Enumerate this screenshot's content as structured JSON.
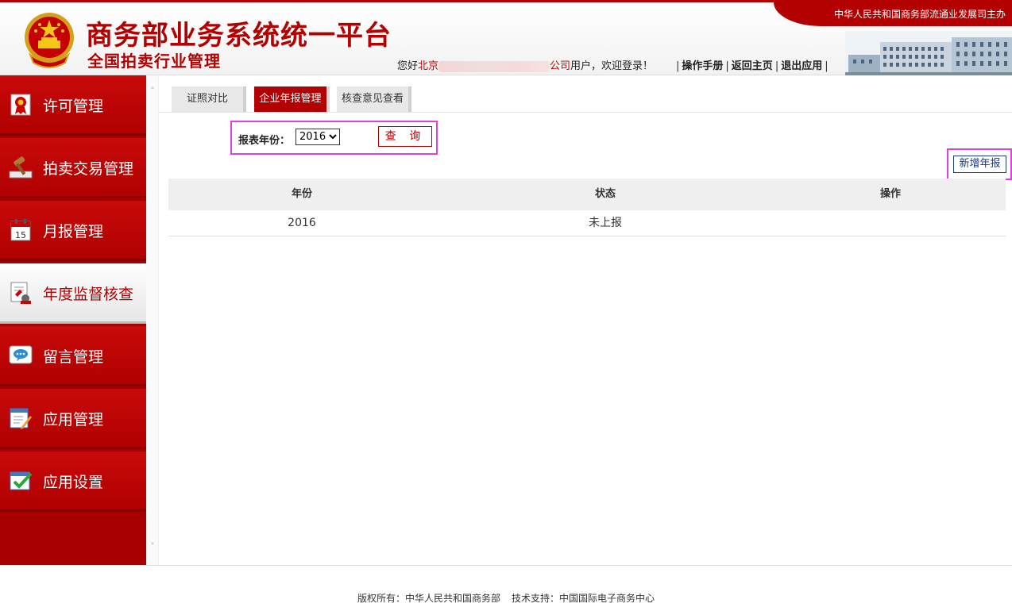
{
  "header": {
    "title_main": "商务部业务系统统一平台",
    "title_sub": "全国拍卖行业管理",
    "sponsor": "中华人民共和国商务部流通业发展司主办",
    "welcome_prefix": "您好",
    "welcome_company_start": "北京",
    "welcome_company_end": "公司",
    "welcome_suffix": "用户，欢迎登录！",
    "links": [
      "操作手册",
      "返回主页",
      "退出应用"
    ]
  },
  "sidebar": {
    "items": [
      {
        "label": "许可管理",
        "icon": "certificate-icon"
      },
      {
        "label": "拍卖交易管理",
        "icon": "gavel-icon"
      },
      {
        "label": "月报管理",
        "icon": "calendar-icon"
      },
      {
        "label": "年度监督核查",
        "icon": "inspection-icon"
      },
      {
        "label": "留言管理",
        "icon": "message-icon"
      },
      {
        "label": "应用管理",
        "icon": "edit-icon"
      },
      {
        "label": "应用设置",
        "icon": "checklist-icon"
      }
    ],
    "active_index": 3
  },
  "tabs": [
    "证照对比",
    "企业年报管理",
    "核查意见查看"
  ],
  "active_tab": 1,
  "query": {
    "label": "报表年份：",
    "selected_year": "2016",
    "button": "查 询"
  },
  "add_button": "新增年报",
  "table": {
    "columns": [
      "年份",
      "状态",
      "操作"
    ],
    "rows": [
      {
        "year": "2016",
        "status": "未上报",
        "action": ""
      }
    ]
  },
  "footer": {
    "copyright": "版权所有：中华人民共和国商务部",
    "support": "技术支持：中国国际电子商务中心"
  },
  "colors": {
    "brand_red": "#b30000",
    "highlight_magenta": "#e040e0"
  }
}
